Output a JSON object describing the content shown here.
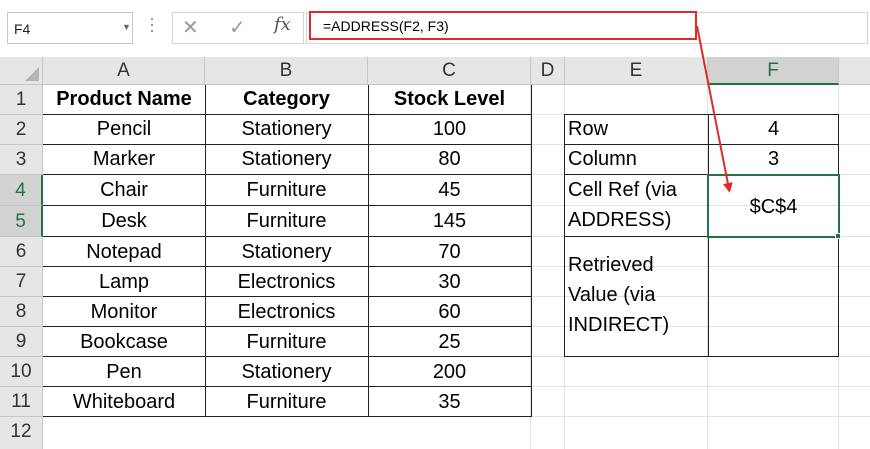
{
  "name_box": {
    "value": "F4",
    "dropdown_icon": "chevron-down-icon"
  },
  "formula_bar": {
    "cancel_icon": "close-icon",
    "enter_icon": "check-icon",
    "fx_label": "fx",
    "formula": "=ADDRESS(F2, F3)"
  },
  "columns": [
    "A",
    "B",
    "C",
    "D",
    "E",
    "F"
  ],
  "selected_column": "F",
  "rows": [
    "1",
    "2",
    "3",
    "4",
    "5",
    "6",
    "7",
    "8",
    "9",
    "10",
    "11",
    "12"
  ],
  "selected_rows": [
    "4",
    "5"
  ],
  "table": {
    "headers": [
      "Product Name",
      "Category",
      "Stock Level"
    ],
    "rows": [
      [
        "Pencil",
        "Stationery",
        "100"
      ],
      [
        "Marker",
        "Stationery",
        "80"
      ],
      [
        "Chair",
        "Furniture",
        "45"
      ],
      [
        "Desk",
        "Furniture",
        "145"
      ],
      [
        "Notepad",
        "Stationery",
        "70"
      ],
      [
        "Lamp",
        "Electronics",
        "30"
      ],
      [
        "Monitor",
        "Electronics",
        "60"
      ],
      [
        "Bookcase",
        "Furniture",
        "25"
      ],
      [
        "Pen",
        "Stationery",
        "200"
      ],
      [
        "Whiteboard",
        "Furniture",
        "35"
      ]
    ]
  },
  "lookup": {
    "row_label": "Row",
    "row_value": "4",
    "column_label": "Column",
    "column_value": "3",
    "cellref_label_1": "Cell Ref (via",
    "cellref_label_2": "ADDRESS)",
    "cellref_value": "$C$4",
    "retrieved_label_1": "Retrieved",
    "retrieved_label_2": "Value (via",
    "retrieved_label_3": "INDIRECT)",
    "retrieved_value": ""
  },
  "colors": {
    "accent": "#217346",
    "annotation": "#e02b2b"
  }
}
